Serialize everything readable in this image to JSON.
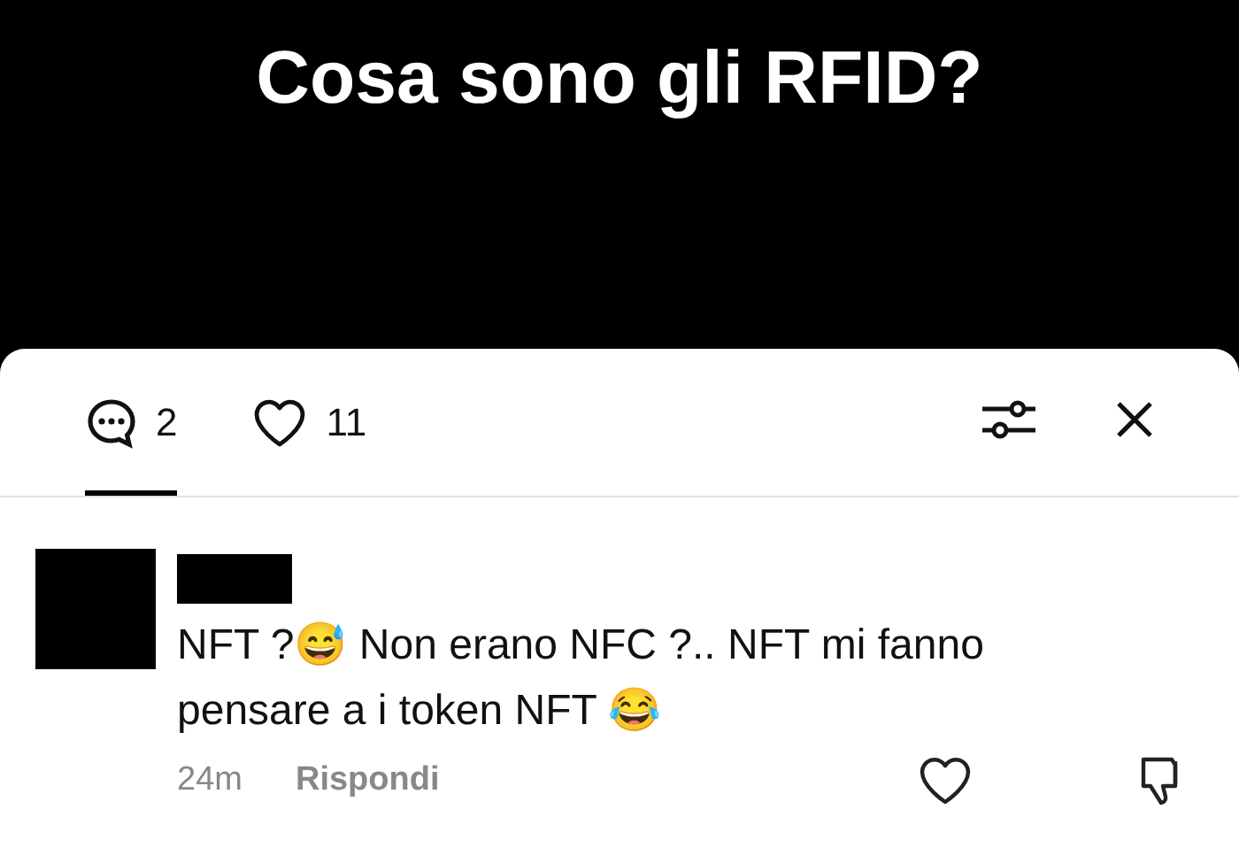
{
  "video": {
    "caption": "Cosa sono gli RFID?"
  },
  "tabs": [
    {
      "kind": "comments",
      "count": "2",
      "selected": true
    },
    {
      "kind": "likes",
      "count": "11",
      "selected": false
    }
  ],
  "comment": {
    "text": "NFT ?😅 Non erano NFC ?.. NFT mi fanno pensare a i token NFT 😂",
    "time": "24m",
    "reply": "Rispondi"
  }
}
